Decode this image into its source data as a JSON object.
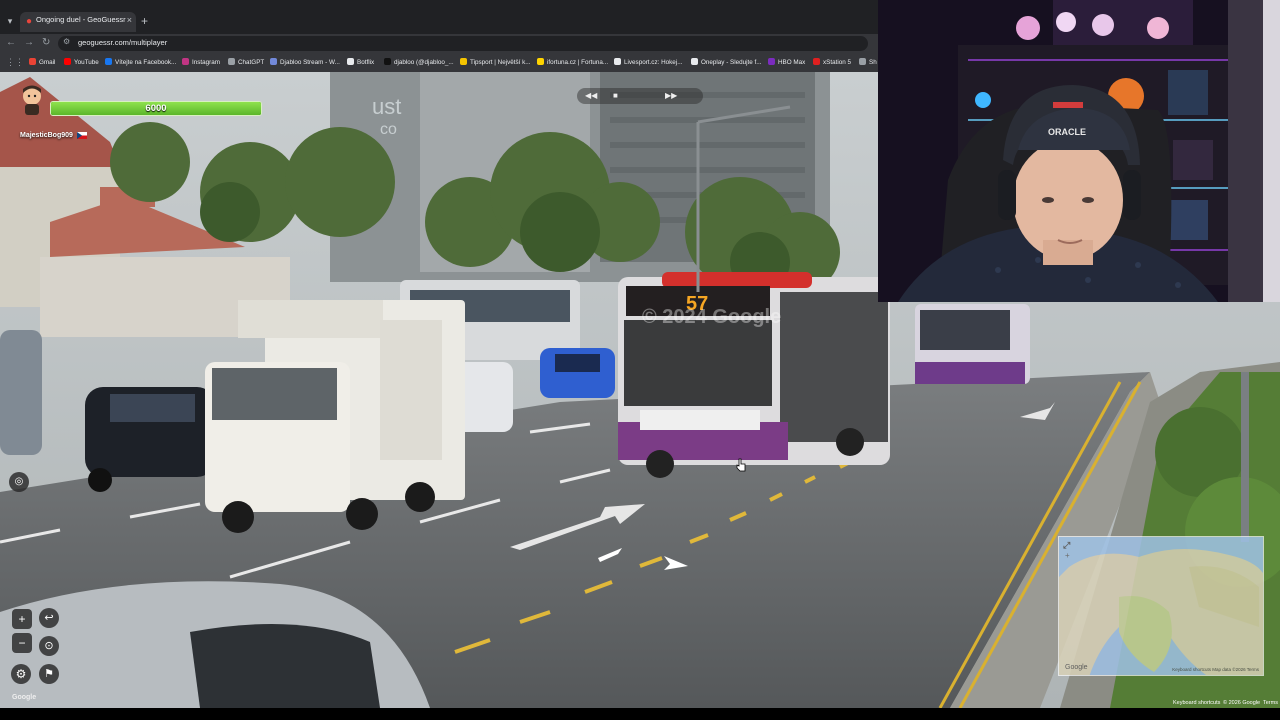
{
  "browser": {
    "tab_title": "Ongoing duel - GeoGuessr",
    "tab_close": "×",
    "new_tab": "+",
    "tab_search": "▾",
    "url": "geoguessr.com/multiplayer",
    "back": "←",
    "forward": "→",
    "reload": "↻",
    "apps_icon": "⋮⋮",
    "bookmarks": [
      {
        "label": "Gmail",
        "color": "#ea4335"
      },
      {
        "label": "YouTube",
        "color": "#ff0000"
      },
      {
        "label": "Vítejte na Facebook...",
        "color": "#1877f2"
      },
      {
        "label": "Instagram",
        "color": "#c13584"
      },
      {
        "label": "ChatGPT",
        "color": "#9aa0a6"
      },
      {
        "label": "Djabloo Stream - W...",
        "color": "#7289da"
      },
      {
        "label": "Botflix",
        "color": "#e8eaed"
      },
      {
        "label": "djabloo (@djabloo_...",
        "color": "#111111"
      },
      {
        "label": "Tipsport | Největší k...",
        "color": "#f5c400"
      },
      {
        "label": "ifortuna.cz | Fortuna...",
        "color": "#ffd400"
      },
      {
        "label": "Livesport.cz: Hokej...",
        "color": "#e8eaed"
      },
      {
        "label": "Oneplay - Sledujte f...",
        "color": "#e8eaed"
      },
      {
        "label": "HBO Max",
        "color": "#7b2cbf"
      },
      {
        "label": "xStation 5",
        "color": "#e02020"
      },
      {
        "label": "Sh",
        "color": "#9aa0a6"
      }
    ]
  },
  "game": {
    "player_name": "MajesticBog909",
    "health": "6000",
    "health_fraction": 1.0,
    "bus_route": "57",
    "watermark": "© 2024 Google",
    "controls": {
      "zoom_in": "+",
      "zoom_out": "−",
      "undo": "↩",
      "checkpoint": "⊙",
      "settings": "⚙",
      "flag": "⚑",
      "camera": "◎"
    },
    "google_logo": "Google",
    "footer": {
      "shortcuts": "Keyboard shortcuts",
      "copyright": "© 2026 Google",
      "terms": "Terms"
    },
    "minimap": {
      "expand": "⤢",
      "plus": "+",
      "google": "Google",
      "attribution": "Keyboard shortcuts  Map data ©2026  Terms"
    },
    "replay_icons": [
      "◀◀",
      "■",
      "▶▶"
    ]
  }
}
